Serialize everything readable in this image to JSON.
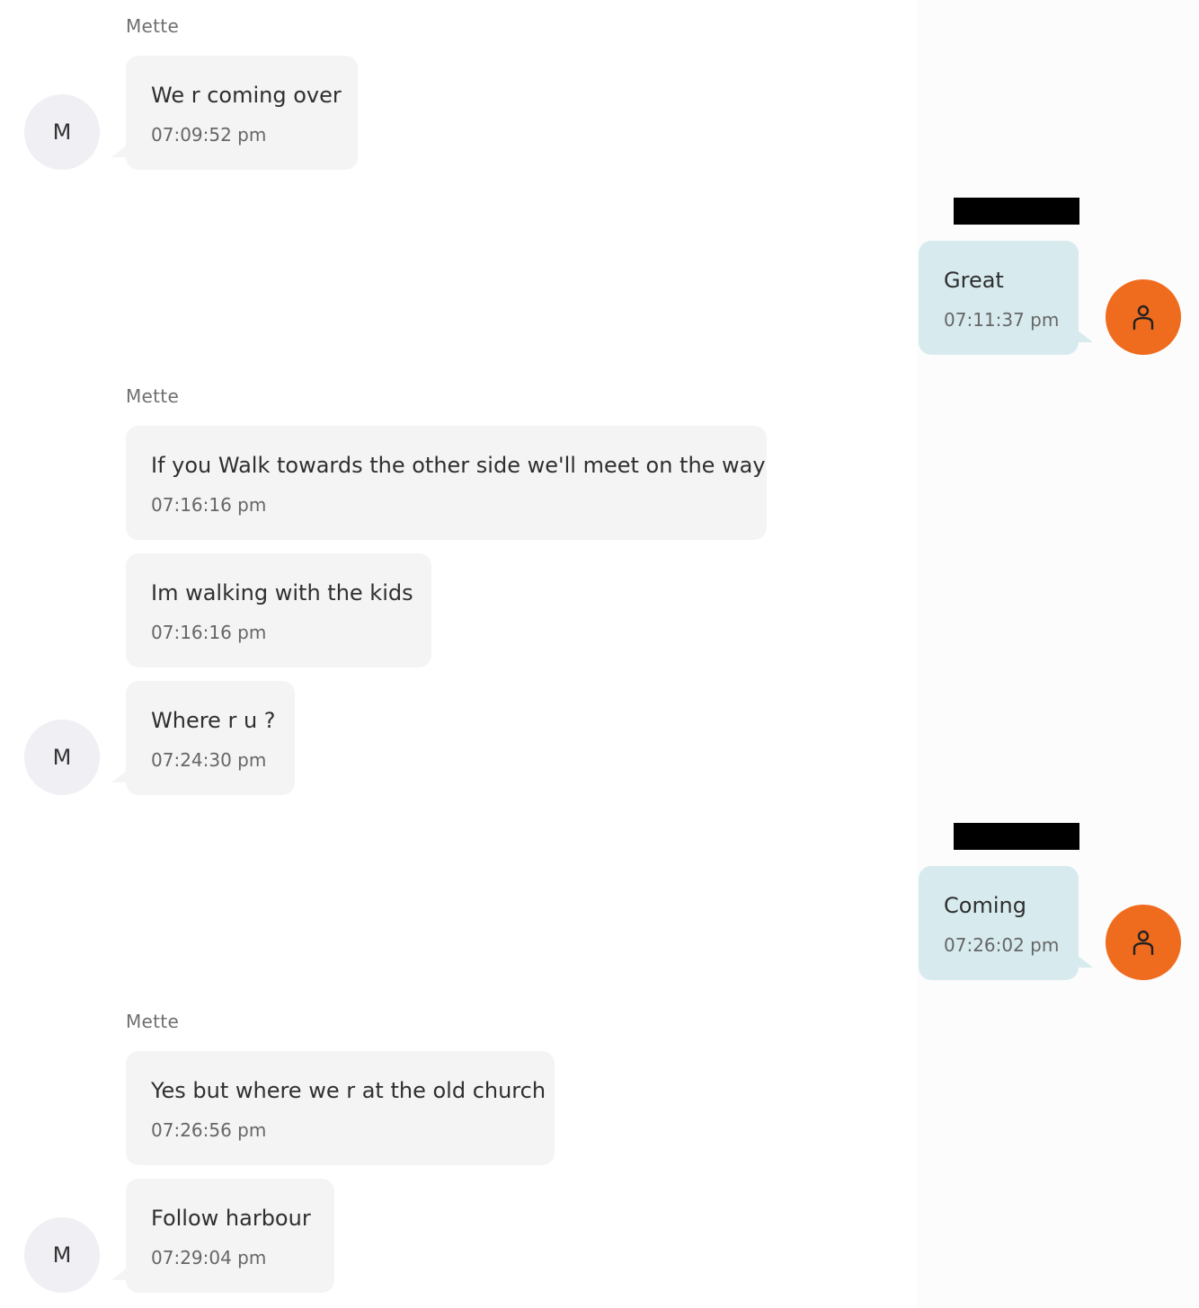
{
  "contact": {
    "name": "Mette",
    "initial": "M"
  },
  "messages": [
    {
      "sender": "Mette",
      "text": "We r coming over",
      "time": "07:09:52 pm"
    },
    {
      "sender": "self",
      "text": "Great",
      "time": "07:11:37 pm"
    },
    {
      "sender": "Mette",
      "text": "If you Walk towards the other side we'll meet on the way",
      "time": "07:16:16 pm"
    },
    {
      "sender": "Mette",
      "text": "Im walking with the kids",
      "time": "07:16:16 pm"
    },
    {
      "sender": "Mette",
      "text": "Where r u ?",
      "time": "07:24:30 pm"
    },
    {
      "sender": "self",
      "text": "Coming",
      "time": "07:26:02 pm"
    },
    {
      "sender": "Mette",
      "text": "Yes but where we r at the old church",
      "time": "07:26:56 pm"
    },
    {
      "sender": "Mette",
      "text": "Follow harbour",
      "time": "07:29:04 pm"
    }
  ],
  "colors": {
    "incoming_bubble": "#f4f4f4",
    "outgoing_bubble": "#d7ebef",
    "outgoing_avatar": "#ef6b1e",
    "incoming_avatar": "#efeff4",
    "redaction": "#000000"
  },
  "icons": {
    "outgoing_avatar": "person-outline-icon"
  }
}
